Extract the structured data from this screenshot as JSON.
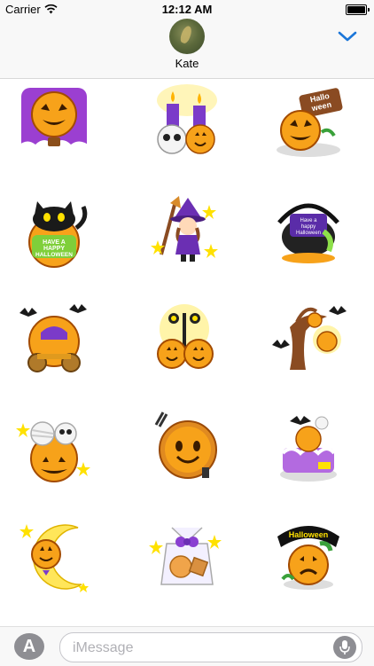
{
  "status_bar": {
    "carrier": "Carrier",
    "time": "12:12 AM",
    "wifi_icon": "wifi-icon",
    "battery_icon": "battery-icon"
  },
  "header": {
    "contact_name": "Kate",
    "avatar_icon": "contact-avatar",
    "expand_icon": "chevron-down-icon",
    "accent_color": "#1b76d9"
  },
  "stickers": [
    {
      "name": "pumpkin hot air balloon"
    },
    {
      "name": "candles with skull and pumpkin"
    },
    {
      "name": "pumpkin with Halloween sign",
      "text": "Hallo ween"
    },
    {
      "name": "black cat on pumpkin",
      "text": "HAVE A HAPPY HALLOWEEN"
    },
    {
      "name": "little witch with broom"
    },
    {
      "name": "cauldron with sign",
      "text": "Have a happy Halloween"
    },
    {
      "name": "pumpkin carriage with bats"
    },
    {
      "name": "pumpkins under street lamp"
    },
    {
      "name": "spooky tree with pumpkin lantern"
    },
    {
      "name": "mummy and skull in pumpkin"
    },
    {
      "name": "pumpkin pie with fork"
    },
    {
      "name": "pumpkin cake with bat"
    },
    {
      "name": "pumpkin on crescent moon"
    },
    {
      "name": "cookies gift bag"
    },
    {
      "name": "sad pumpkin with Halloween banner",
      "text": "Halloween"
    }
  ],
  "compose": {
    "app_store_icon": "app-store-icon",
    "placeholder": "iMessage",
    "mic_icon": "microphone-icon"
  }
}
